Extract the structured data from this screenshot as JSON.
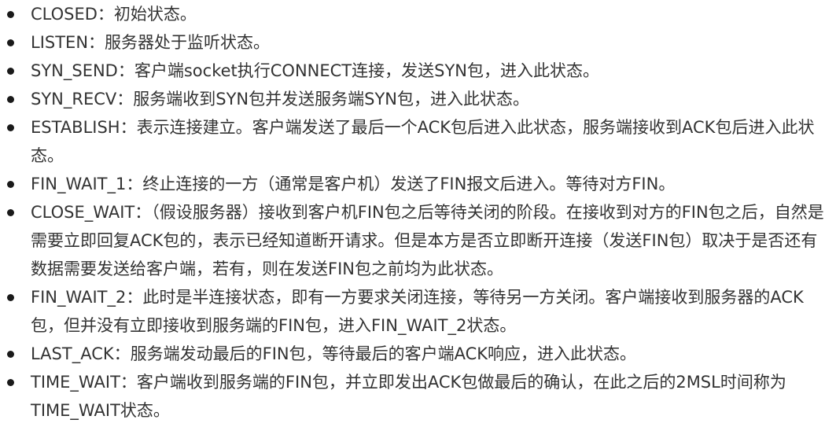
{
  "items": [
    {
      "name": "CLOSED",
      "desc": "初始状态。"
    },
    {
      "name": "LISTEN",
      "desc": "服务器处于监听状态。"
    },
    {
      "name": "SYN_SEND",
      "desc": "客户端socket执行CONNECT连接，发送SYN包，进入此状态。"
    },
    {
      "name": "SYN_RECV",
      "desc": "服务端收到SYN包并发送服务端SYN包，进入此状态。"
    },
    {
      "name": "ESTABLISH",
      "desc": "表示连接建立。客户端发送了最后一个ACK包后进入此状态，服务端接收到ACK包后进入此状态。"
    },
    {
      "name": "FIN_WAIT_1",
      "desc": "终止连接的一方（通常是客户机）发送了FIN报文后进入。等待对方FIN。"
    },
    {
      "name": "CLOSE_WAIT",
      "desc": "（假设服务器）接收到客户机FIN包之后等待关闭的阶段。在接收到对方的FIN包之后，自然是需要立即回复ACK包的，表示已经知道断开请求。但是本方是否立即断开连接（发送FIN包）取决于是否还有数据需要发送给客户端，若有，则在发送FIN包之前均为此状态。"
    },
    {
      "name": "FIN_WAIT_2",
      "desc": "此时是半连接状态，即有一方要求关闭连接，等待另一方关闭。客户端接收到服务器的ACK包，但并没有立即接收到服务端的FIN包，进入FIN_WAIT_2状态。"
    },
    {
      "name": "LAST_ACK",
      "desc": "服务端发动最后的FIN包，等待最后的客户端ACK响应，进入此状态。"
    },
    {
      "name": "TIME_WAIT",
      "desc": "客户端收到服务端的FIN包，并立即发出ACK包做最后的确认，在此之后的2MSL时间称为TIME_WAIT状态。"
    }
  ],
  "separator": "："
}
